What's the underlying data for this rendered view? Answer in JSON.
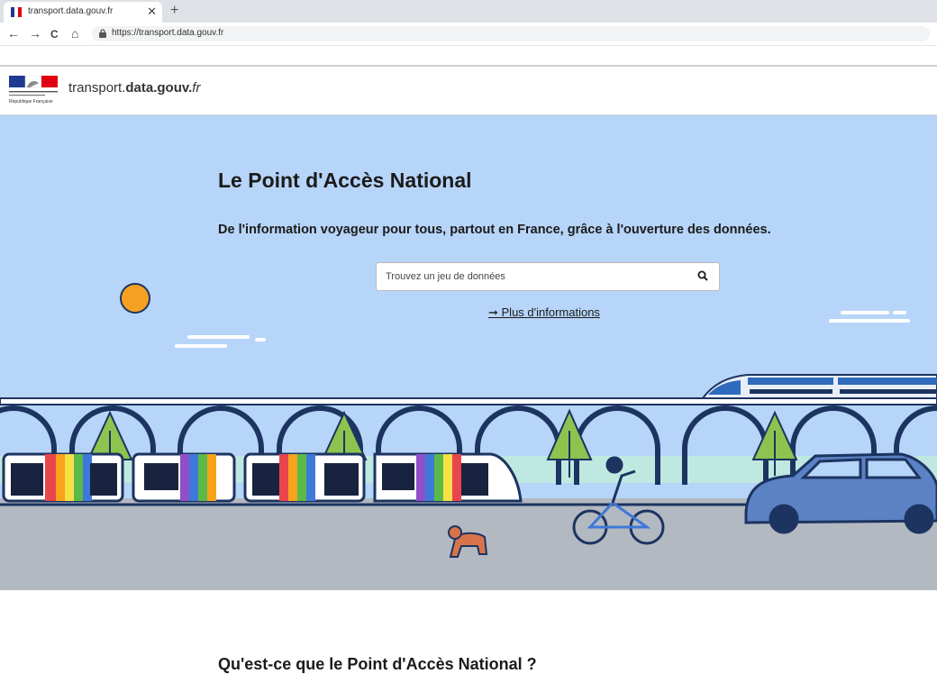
{
  "browser": {
    "tab_title": "transport.data.gouv.fr",
    "tab_close": "✕",
    "new_tab": "+",
    "url": "https://transport.data.gouv.fr",
    "nav": {
      "back": "←",
      "forward": "→",
      "reload": "C",
      "home": "⌂"
    }
  },
  "header": {
    "logo_caption": "République Française",
    "site_name_prefix": "transport.",
    "site_name_bold": "data.gouv.",
    "site_name_suffix": "fr"
  },
  "hero": {
    "title": "Le Point d'Accès National",
    "subtitle": "De l'information voyageur pour tous, partout en France, grâce à l'ouverture des données.",
    "search_placeholder": "Trouvez un jeu de données",
    "more_info": "➞ Plus d'informations"
  },
  "section": {
    "title": "Qu'est-ce que le Point d'Accès National ?"
  },
  "colors": {
    "sky": "#b7d5f9",
    "sun": "#f5a023",
    "ground": "#b3b9c1",
    "arch": "#1d3461",
    "car": "#5b82c4",
    "tree": "#8cc44f",
    "tgv": "#2f6bbd"
  }
}
